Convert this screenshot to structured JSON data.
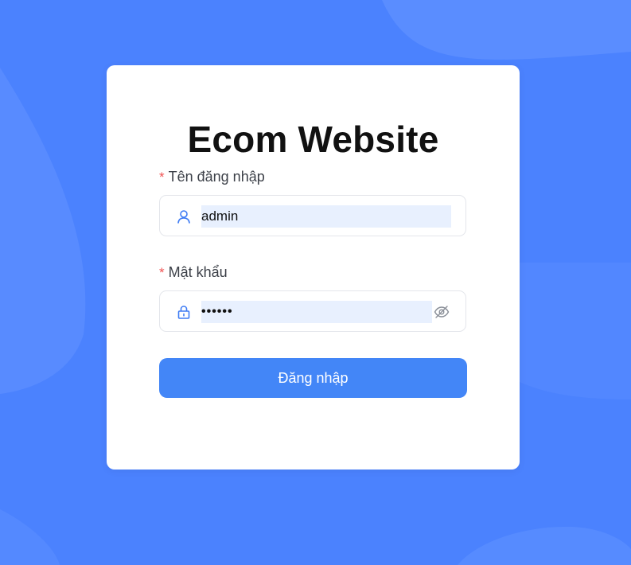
{
  "app": {
    "title": "Ecom Website"
  },
  "form": {
    "username": {
      "label": "Tên đăng nhập",
      "required_mark": "*",
      "value": "admin",
      "icon": "user-icon"
    },
    "password": {
      "label": "Mật khẩu",
      "required_mark": "*",
      "value_masked": "••••••",
      "icon": "lock-icon",
      "toggle_icon": "eye-off-icon"
    },
    "submit_label": "Đăng nhập"
  },
  "colors": {
    "background": "#4b82fe",
    "card": "#ffffff",
    "primary_button": "#4386f7",
    "required_mark": "#f05454",
    "icon_accent": "#3f7cf4",
    "autofill_fill": "#e8f0fe"
  }
}
